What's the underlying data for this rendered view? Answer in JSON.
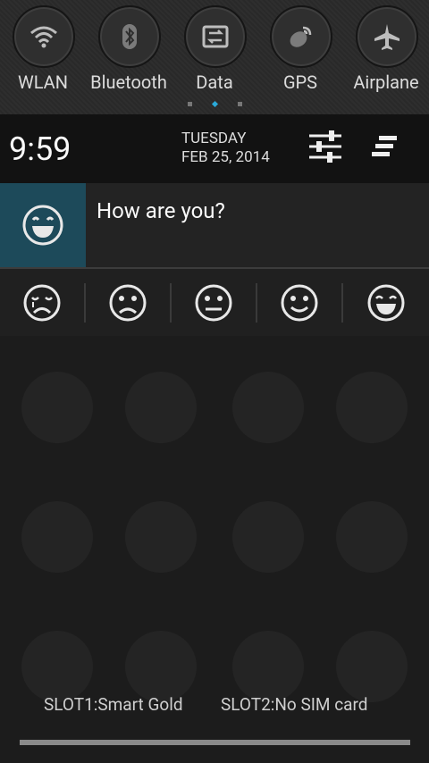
{
  "quick_toggles": [
    {
      "label": "WLAN",
      "icon": "wifi-icon"
    },
    {
      "label": "Bluetooth",
      "icon": "bluetooth-icon"
    },
    {
      "label": "Data",
      "icon": "data-transfer-icon"
    },
    {
      "label": "GPS",
      "icon": "gps-icon"
    },
    {
      "label": "Airplane",
      "icon": "airplane-icon"
    }
  ],
  "status": {
    "time": "9:59",
    "day": "TUESDAY",
    "date": "FEB 25, 2014"
  },
  "notification": {
    "title": "How are you?",
    "icon": "laughing-face-icon",
    "accent": "#1d4a5a"
  },
  "moods": [
    "crying-face-icon",
    "sad-face-icon",
    "neutral-face-icon",
    "smile-face-icon",
    "laughing-face-icon"
  ],
  "sim": {
    "slot1": "SLOT1:Smart Gold",
    "slot2": "SLOT2:No SIM card"
  },
  "pager": {
    "active_index": 1,
    "total": 3,
    "accent": "#2aa9d9"
  }
}
